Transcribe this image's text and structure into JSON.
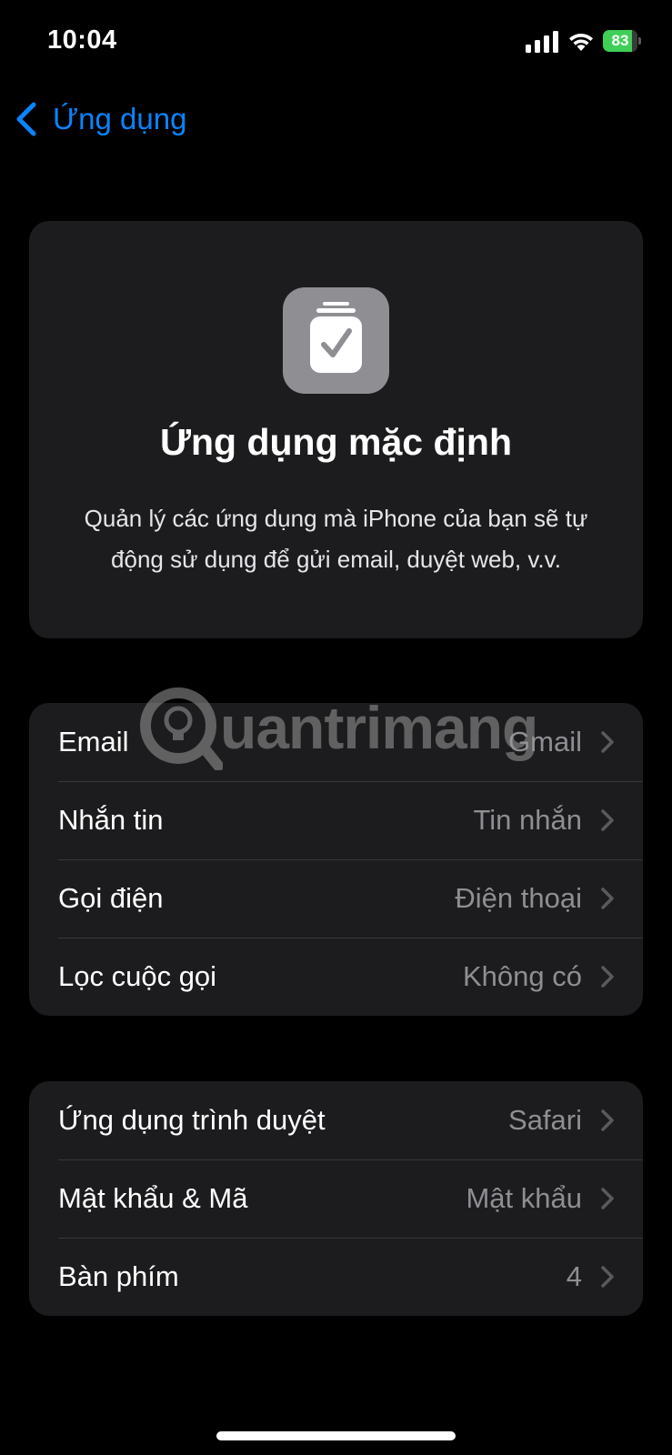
{
  "status_bar": {
    "time": "10:04",
    "battery_text": "83",
    "battery_level_percent": 83,
    "battery_color": "#3fcf57"
  },
  "nav": {
    "back_label": "Ứng dụng",
    "back_icon": "chevron-left-icon",
    "accent_color": "#0a84ff"
  },
  "hero": {
    "icon": "checklist-icon",
    "title": "Ứng dụng mặc định",
    "description": "Quản lý các ứng dụng mà iPhone của bạn sẽ tự động sử dụng để gửi email, duyệt web, v.v."
  },
  "watermark": {
    "text": "uantrimang",
    "icon": "lightbulb-logo-icon"
  },
  "groups": [
    {
      "rows": [
        {
          "label": "Email",
          "value": "Gmail"
        },
        {
          "label": "Nhắn tin",
          "value": "Tin nhắn"
        },
        {
          "label": "Gọi điện",
          "value": "Điện thoại"
        },
        {
          "label": "Lọc cuộc gọi",
          "value": "Không có"
        }
      ]
    },
    {
      "rows": [
        {
          "label": "Ứng dụng trình duyệt",
          "value": "Safari"
        },
        {
          "label": "Mật khẩu & Mã",
          "value": "Mật khẩu"
        },
        {
          "label": "Bàn phím",
          "value": "4"
        }
      ]
    }
  ]
}
